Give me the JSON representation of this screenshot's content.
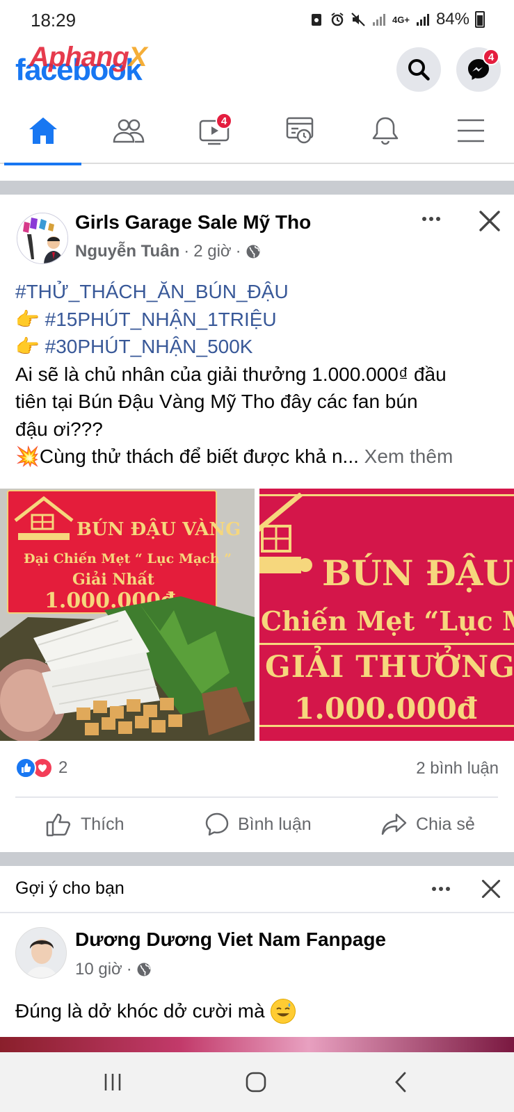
{
  "status_bar": {
    "time": "18:29",
    "network": "4G+",
    "battery": "84%"
  },
  "header": {
    "logo": "facebook",
    "watermark": "Aphang",
    "watermark_x": "X",
    "messenger_badge": "4"
  },
  "tabs": [
    {
      "name": "home",
      "icon": "home-icon",
      "active": true
    },
    {
      "name": "friends",
      "icon": "friends-icon"
    },
    {
      "name": "watch",
      "icon": "video-icon",
      "badge": "4"
    },
    {
      "name": "memories",
      "icon": "memories-icon"
    },
    {
      "name": "notifications",
      "icon": "bell-icon"
    },
    {
      "name": "menu",
      "icon": "menu-icon"
    }
  ],
  "post": {
    "group": "Girls Garage Sale Mỹ Tho",
    "author": "Nguyễn Tuân",
    "time": "2 giờ",
    "lines": {
      "hashtag1": "#THỬ_THÁCH_ĂN_BÚN_ĐẬU",
      "hashtag2": "#15PHÚT_NHẬN_1TRIỆU",
      "hashtag3": "#30PHÚT_NHẬN_500K",
      "text1": "Ai sẽ là chủ nhân của giải thưởng 1.000.000₫ đầu",
      "text2": "tiên tại Bún Đậu Vàng Mỹ Tho đây các fan bún",
      "text3": "đậu ơi???",
      "text4": "Cùng thử thách để biết được khả n...",
      "see_more": "Xem thêm"
    },
    "image1": {
      "sign_name": "BÚN ĐẬU VÀNG",
      "sign_line2": "Đại Chiến Mẹt “ Lục Mạch ”",
      "sign_line3": "Giải Nhất",
      "sign_prize": "1.000.000đ"
    },
    "image2": {
      "sign_name": "BÚN ĐẬU V",
      "sign_line2": "Chiến Mẹt “Lục Ma",
      "sign_line3": "GIẢI THƯỞNG",
      "sign_prize": "1.000.000đ"
    },
    "reaction_count": "2",
    "comment_count": "2 bình luận",
    "actions": {
      "like": "Thích",
      "comment": "Bình luận",
      "share": "Chia sẻ"
    }
  },
  "suggestion": {
    "heading": "Gợi ý cho bạn",
    "page_name": "Dương Dương Viet Nam Fanpage",
    "time": "10 giờ",
    "text": "Đúng là dở khóc dở cười mà"
  },
  "colors": {
    "fb_blue": "#1877f2",
    "hashtag": "#385898",
    "secondary_text": "#65676b",
    "badge_red": "#e41e3f"
  }
}
